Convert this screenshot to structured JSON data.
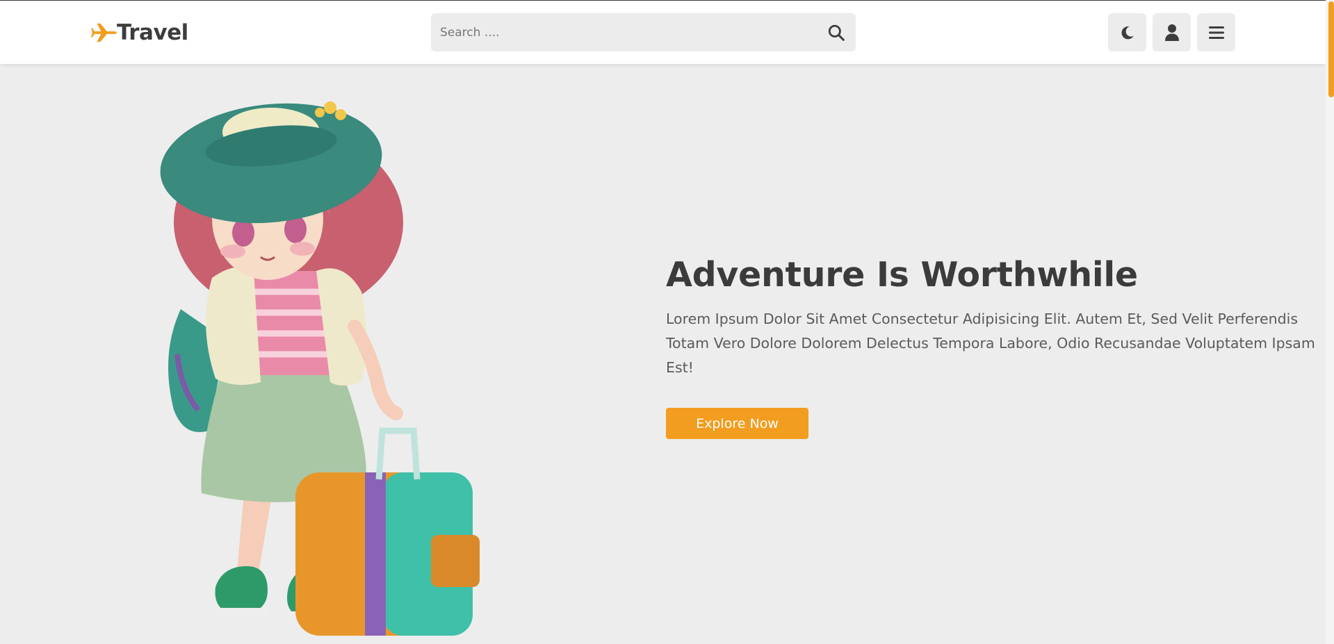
{
  "header": {
    "logo_text": "Travel",
    "logo_icon": "plane-icon",
    "search": {
      "placeholder": "Search ....",
      "icon": "search-icon"
    },
    "buttons": [
      {
        "name": "theme-toggle",
        "icon": "moon-icon"
      },
      {
        "name": "account",
        "icon": "user-icon"
      },
      {
        "name": "menu",
        "icon": "menu-icon"
      }
    ]
  },
  "hero": {
    "title": "Adventure Is Worthwhile",
    "description": "Lorem Ipsum Dolor Sit Amet Consectetur Adipisicing Elit. Autem Et, Sed Velit Perferendis Totam Vero Dolore Dolorem Delectus Tempora Labore, Odio Recusandae Voluptatem Ipsam Est!",
    "cta_label": "Explore Now",
    "illustration": "girl-with-suitcase-illustration"
  },
  "colors": {
    "accent": "#f29d1f",
    "text_dark": "#3b3b3b",
    "background": "#ededed",
    "header_bg": "#ffffff",
    "control_bg": "#ececec"
  }
}
